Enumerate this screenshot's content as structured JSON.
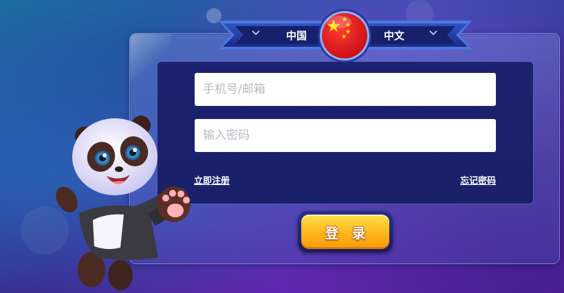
{
  "language_selector": {
    "region_label": "中国",
    "language_label": "中文",
    "flag_icon": "china-flag-icon"
  },
  "login_form": {
    "account_placeholder": "手机号/邮箱",
    "password_placeholder": "输入密码",
    "register_link": "立即注册",
    "forgot_password_link": "忘记密码",
    "login_button": "登 录"
  },
  "mascot": {
    "icon": "panda-mascot"
  },
  "colors": {
    "panel_inner": "#1c2270",
    "button_gold": "#ffb51c",
    "flag_red": "#e0161b",
    "flag_star": "#ffde00"
  }
}
